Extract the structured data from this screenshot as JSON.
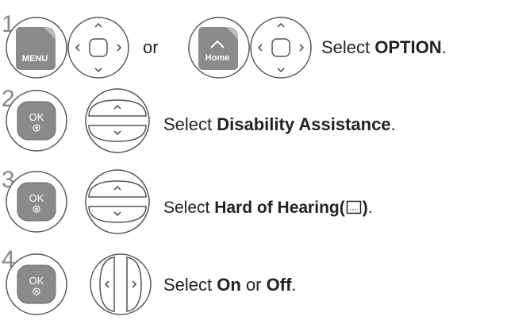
{
  "steps": [
    {
      "number": "1",
      "buttons": {
        "menu_label": "MENU",
        "home_label": "Home",
        "or_text": "or"
      },
      "instruction": {
        "prefix": "Select ",
        "bold": "OPTION",
        "suffix": "."
      }
    },
    {
      "number": "2",
      "buttons": {
        "ok_label": "OK"
      },
      "instruction": {
        "prefix": "Select ",
        "bold": "Disability Assistance",
        "suffix": "."
      }
    },
    {
      "number": "3",
      "buttons": {
        "ok_label": "OK"
      },
      "instruction": {
        "prefix": "Select ",
        "bold": "Hard of Hearing(",
        "bold_after_icon": ")",
        "suffix": "."
      }
    },
    {
      "number": "4",
      "buttons": {
        "ok_label": "OK"
      },
      "instruction": {
        "prefix": "Select ",
        "bold": "On",
        "middle": " or ",
        "bold2": "Off",
        "suffix": "."
      }
    }
  ],
  "icons": {
    "menu_corner": "menu-button-icon",
    "home_icon": "home-icon",
    "nav_dpad": "dpad-icon",
    "ok_dot": "ok-dot-icon",
    "subtitle_icon": "subtitle-icon"
  },
  "colors": {
    "button_gray": "#8a8a8a",
    "outline": "#555555",
    "text": "#222222"
  }
}
